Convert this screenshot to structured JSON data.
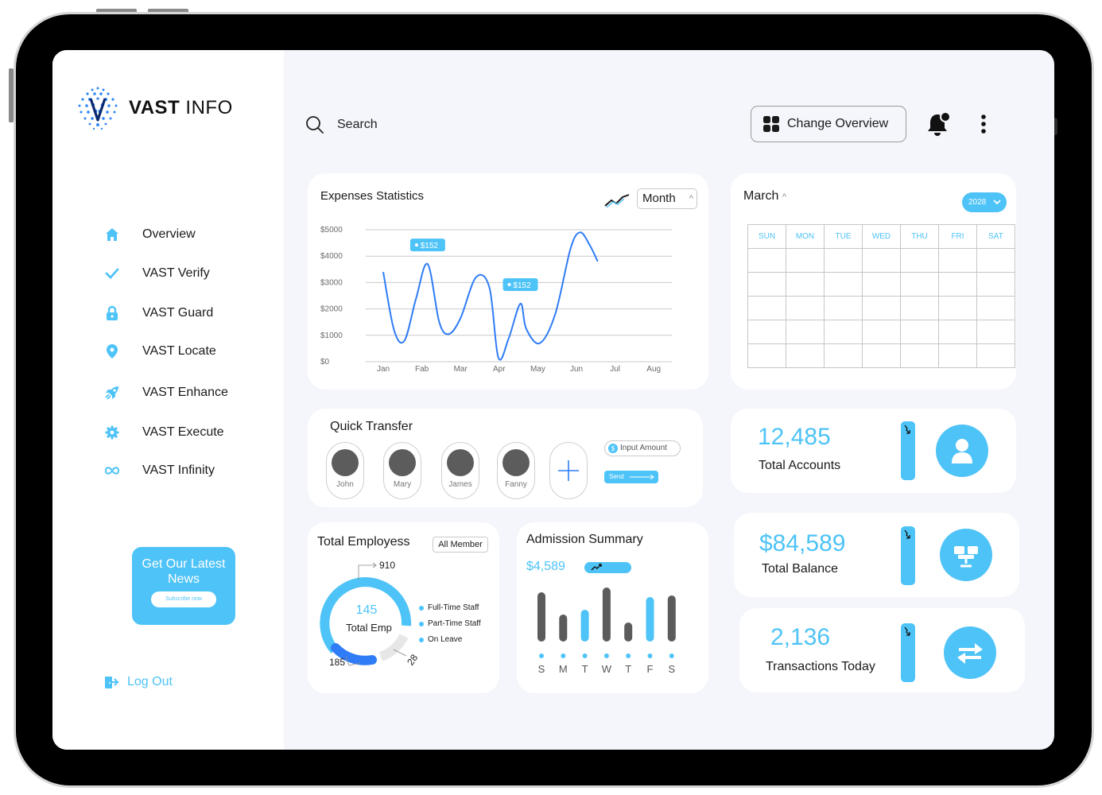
{
  "brand": {
    "name_bold": "VAST",
    "name_light": " INFO"
  },
  "sidebar": {
    "items": [
      {
        "label": "Overview",
        "icon": "home-icon"
      },
      {
        "label": "VAST Verify",
        "icon": "check-icon"
      },
      {
        "label": "VAST Guard",
        "icon": "lock-icon"
      },
      {
        "label": "VAST Locate",
        "icon": "location-pin-icon"
      },
      {
        "label": "VAST Enhance",
        "icon": "rocket-icon"
      },
      {
        "label": "VAST Execute",
        "icon": "gear-icon"
      },
      {
        "label": "VAST Infinity",
        "icon": "infinity-icon"
      }
    ],
    "news": {
      "title": "Get Our Latest News",
      "button": "Subscribe now"
    },
    "logout": "Log Out"
  },
  "header": {
    "search_label": "Search",
    "change_overview": "Change Overview"
  },
  "expenses": {
    "title": "Expenses Statistics",
    "period": "Month",
    "tooltips": [
      "$152",
      "$152"
    ]
  },
  "chart_data": {
    "type": "line",
    "x": [
      "Jan",
      "Fab",
      "Mar",
      "Apr",
      "May",
      "Jun",
      "Jul",
      "Aug"
    ],
    "yticks": [
      "$0",
      "$1000",
      "$2000",
      "$3000",
      "$4000",
      "$5000"
    ],
    "ylim": [
      0,
      5000
    ],
    "points": [
      [
        0,
        3400
      ],
      [
        0.28,
        1200
      ],
      [
        0.55,
        800
      ],
      [
        0.85,
        2400
      ],
      [
        1.15,
        3700
      ],
      [
        1.45,
        1500
      ],
      [
        1.7,
        1050
      ],
      [
        2.0,
        1650
      ],
      [
        2.4,
        3200
      ],
      [
        2.75,
        2800
      ],
      [
        2.98,
        150
      ],
      [
        3.25,
        900
      ],
      [
        3.55,
        2200
      ],
      [
        3.7,
        1250
      ],
      [
        4.05,
        700
      ],
      [
        4.45,
        1800
      ],
      [
        4.85,
        4300
      ],
      [
        5.1,
        4900
      ],
      [
        5.35,
        4400
      ],
      [
        5.55,
        3800
      ]
    ],
    "grid": true,
    "legend": "none",
    "color": "#2f7cf6"
  },
  "calendar": {
    "month": "March",
    "year": "2028",
    "days": [
      "SUN",
      "MON",
      "TUE",
      "WED",
      "THU",
      "FRI",
      "SAT"
    ]
  },
  "quick_transfer": {
    "title": "Quick Transfer",
    "contacts": [
      "John",
      "Mary",
      "James",
      "Fanny"
    ],
    "input_amount": "Input Amount",
    "send": "Send"
  },
  "stats": [
    {
      "value": "12,485",
      "label": "Total Accounts",
      "icon": "user-icon"
    },
    {
      "value": "$84,589",
      "label": "Total Balance",
      "icon": "wallet-network-icon"
    },
    {
      "value": "2,136",
      "label": "Transactions Today",
      "icon": "exchange-arrows-icon"
    }
  ],
  "employees": {
    "title": "Total Employess",
    "filter": "All Member",
    "center_value": "145",
    "center_label": "Total Emp",
    "callouts": [
      "910",
      "185",
      "28"
    ],
    "legend": [
      "Full-Time Staff",
      "Part-Time Staff",
      "On Leave"
    ]
  },
  "admission": {
    "title": "Admission Summary",
    "value": "$4,589",
    "days": [
      "S",
      "M",
      "T",
      "W",
      "T",
      "F",
      "S"
    ],
    "bars": [
      {
        "value": 62,
        "color": "#5c5c5c"
      },
      {
        "value": 34,
        "color": "#5c5c5c"
      },
      {
        "value": 40,
        "color": "#4ec3f7"
      },
      {
        "value": 68,
        "color": "#5c5c5c"
      },
      {
        "value": 24,
        "color": "#5c5c5c"
      },
      {
        "value": 56,
        "color": "#4ec3f7"
      },
      {
        "value": 58,
        "color": "#5c5c5c"
      }
    ]
  },
  "colors": {
    "accent": "#4ec3f7",
    "line": "#2f7cf6",
    "dark": "#5c5c5c"
  }
}
